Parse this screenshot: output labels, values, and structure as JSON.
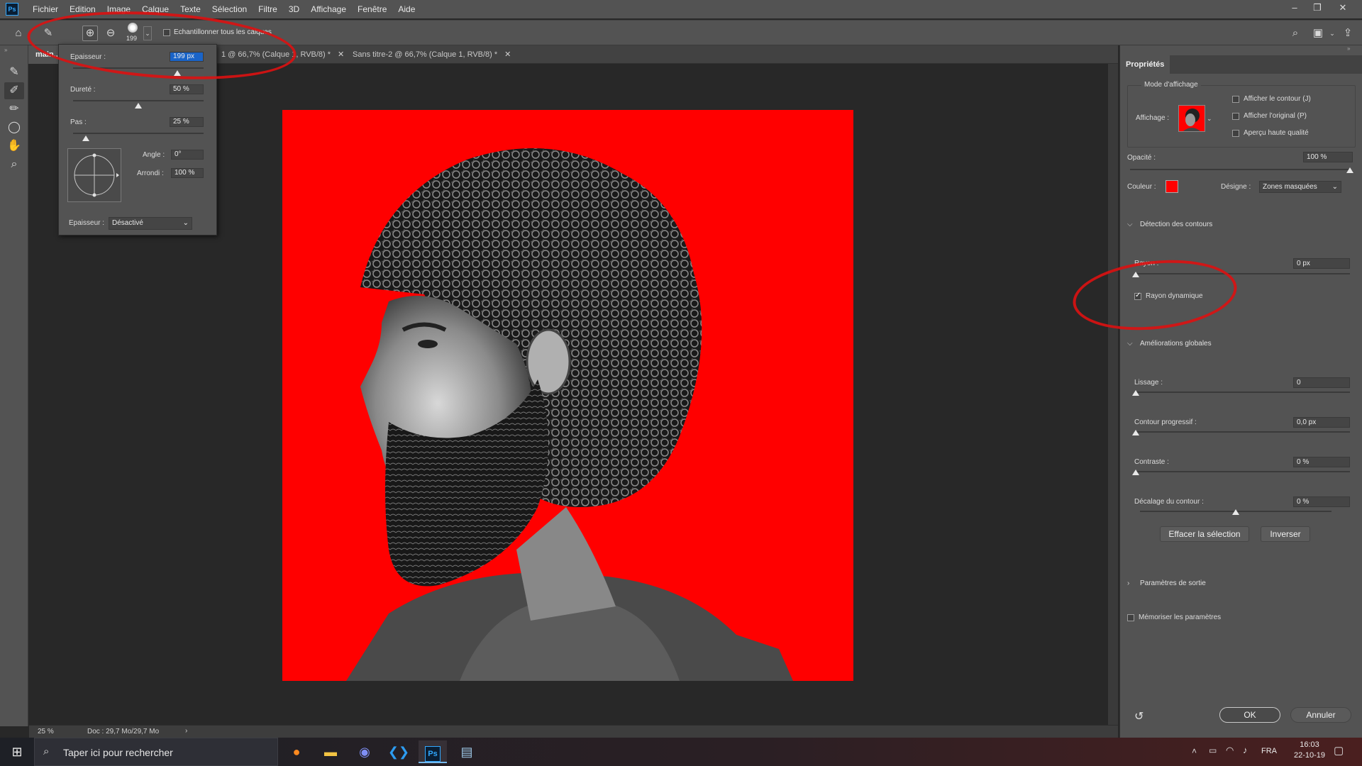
{
  "app": {
    "logo": "Ps",
    "menu": [
      "Fichier",
      "Edition",
      "Image",
      "Calque",
      "Texte",
      "Sélection",
      "Filtre",
      "3D",
      "Affichage",
      "Fenêtre",
      "Aide"
    ],
    "window_controls": [
      "minimize-icon",
      "restore-icon",
      "close-icon"
    ]
  },
  "options_bar": {
    "brush_size_preview": "199",
    "sample_all_layers": "Echantillonner tous les calques"
  },
  "tabs": [
    {
      "label": "main..."
    },
    {
      "label": "1 @ 66,7% (Calque 1, RVB/8) *"
    },
    {
      "label": "Sans titre-2 @ 66,7% (Calque 1, RVB/8) *"
    }
  ],
  "brush_popup": {
    "size_label": "Epaisseur :",
    "size_value": "199 px",
    "size_frac": 0.8,
    "hardness_label": "Dureté :",
    "hardness_value": "50 %",
    "hardness_frac": 0.5,
    "spacing_label": "Pas :",
    "spacing_value": "25 %",
    "spacing_frac": 0.1,
    "angle_label": "Angle :",
    "angle_value": "0°",
    "roundness_label": "Arrondi :",
    "roundness_value": "100 %",
    "pressure_label": "Epaisseur :",
    "pressure_value": "Désactivé"
  },
  "status": {
    "zoom": "25 %",
    "doc": "Doc : 29,7 Mo/29,7 Mo"
  },
  "properties": {
    "tab": "Propriétés",
    "view_mode": {
      "title": "Mode d'affichage",
      "view_label": "Affichage :",
      "show_edge": "Afficher le contour (J)",
      "show_original": "Afficher l'original (P)",
      "hq_preview": "Aperçu haute qualité"
    },
    "opacity_label": "Opacité :",
    "opacity_value": "100 %",
    "opacity_frac": 1.0,
    "color_label": "Couleur :",
    "color_value": "#ff0000",
    "indicates_label": "Désigne :",
    "indicates_value": "Zones masquées",
    "edge_detection": {
      "title": "Détection des contours",
      "radius_label": "Rayon :",
      "radius_value": "0 px",
      "radius_frac": 0.0,
      "smart_radius": "Rayon dynamique"
    },
    "global_refinements": {
      "title": "Améliorations globales",
      "smooth_label": "Lissage :",
      "smooth_value": "0",
      "smooth_frac": 0.0,
      "feather_label": "Contour progressif :",
      "feather_value": "0,0 px",
      "feather_frac": 0.0,
      "contrast_label": "Contraste :",
      "contrast_value": "0 %",
      "contrast_frac": 0.0,
      "shift_label": "Décalage du contour :",
      "shift_value": "0 %",
      "shift_frac": 0.5
    },
    "clear_selection": "Effacer la sélection",
    "invert": "Inverser",
    "output_settings": "Paramètres de sortie",
    "remember": "Mémoriser les paramètres",
    "ok": "OK",
    "cancel": "Annuler"
  },
  "taskbar": {
    "search_placeholder": "Taper ici pour rechercher",
    "language": "FRA",
    "time": "16:03",
    "date": "22-10-19"
  }
}
